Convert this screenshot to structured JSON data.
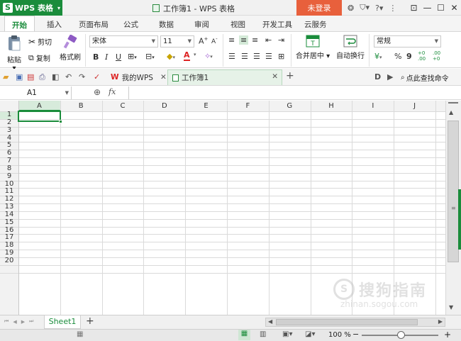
{
  "app": {
    "name": "WPS 表格",
    "window_title": "工作簿1 - WPS 表格",
    "login_label": "未登录"
  },
  "menu": {
    "tabs": [
      "开始",
      "插入",
      "页面布局",
      "公式",
      "数据",
      "审阅",
      "视图",
      "开发工具",
      "云服务"
    ],
    "active": "开始"
  },
  "ribbon": {
    "paste": "粘贴",
    "cut": "剪切",
    "copy": "复制",
    "format_painter": "格式刷",
    "font_name": "宋体",
    "font_size": "11",
    "bold": "B",
    "italic": "I",
    "underline": "U",
    "merge_center": "合并居中",
    "wrap_text": "自动换行",
    "number_format": "常规",
    "percent": "%",
    "comma": "9"
  },
  "tabs": {
    "home_tab": "我的WPS",
    "doc_tab": "工作簿1"
  },
  "quickbar": {
    "search_label": "点此查找命令"
  },
  "formula_bar": {
    "cell_ref": "A1",
    "fx": "fx"
  },
  "grid": {
    "columns": [
      "A",
      "B",
      "C",
      "D",
      "E",
      "F",
      "G",
      "H",
      "I",
      "J"
    ],
    "rows": [
      "1",
      "2",
      "3",
      "4",
      "5",
      "6",
      "7",
      "8",
      "9",
      "10",
      "11",
      "12",
      "13",
      "14",
      "15",
      "16",
      "17",
      "18",
      "19",
      "20"
    ],
    "selected_cell": "A1"
  },
  "sheets": {
    "tabs": [
      "Sheet1"
    ],
    "add": "+"
  },
  "status": {
    "zoom": "100 %",
    "zoom_minus": "−",
    "zoom_plus": "+"
  },
  "watermark": {
    "text": "搜狗指南",
    "url": "zhinan.sogou.com"
  },
  "colors": {
    "brand": "#1a8c3b",
    "login": "#e8603c",
    "selection": "#1a8c3b"
  }
}
